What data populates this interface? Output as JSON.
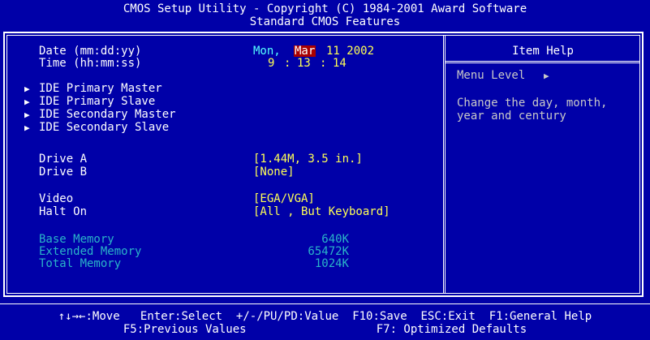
{
  "header": {
    "title": "CMOS Setup Utility - Copyright (C) 1984-2001 Award Software",
    "subtitle": "Standard CMOS Features"
  },
  "fields": {
    "date_label": "Date (mm:dd:yy)",
    "date_day": "Mon,",
    "date_month": "Mar",
    "date_rest": "11 2002",
    "time_label": "Time (hh:mm:ss)",
    "time_h": "9",
    "time_sep1": ":",
    "time_m": "13",
    "time_sep2": ":",
    "time_s": "14",
    "ide": [
      "IDE Primary Master",
      "IDE Primary Slave",
      "IDE Secondary Master",
      "IDE Secondary Slave"
    ],
    "ide_marker": "▶",
    "drive_a_label": "Drive A",
    "drive_a_value": "[1.44M, 3.5 in.]",
    "drive_b_label": "Drive B",
    "drive_b_value": "[None]",
    "video_label": "Video",
    "video_value": "[EGA/VGA]",
    "halt_label": "Halt On",
    "halt_value": "[All , But Keyboard]",
    "base_mem_label": "Base Memory",
    "base_mem_value": "640K",
    "ext_mem_label": "Extended Memory",
    "ext_mem_value": "65472K",
    "total_mem_label": "Total Memory",
    "total_mem_value": "1024K"
  },
  "help": {
    "title": "Item Help",
    "menu_level": "Menu Level",
    "menu_level_marker": "▶",
    "text_line1": "Change the day, month,",
    "text_line2": "year and century"
  },
  "footer": {
    "line1": "↑↓→←:Move   Enter:Select  +/-/PU/PD:Value  F10:Save  ESC:Exit  F1:General Help",
    "line2": "F5:Previous Values                   F7: Optimized Defaults"
  },
  "colors": {
    "background": "#0000a8",
    "label": "#ffffff",
    "value": "#ffff55",
    "datetime": "#55ffff",
    "memory": "#2ab4c8",
    "highlight": "#a80000"
  }
}
